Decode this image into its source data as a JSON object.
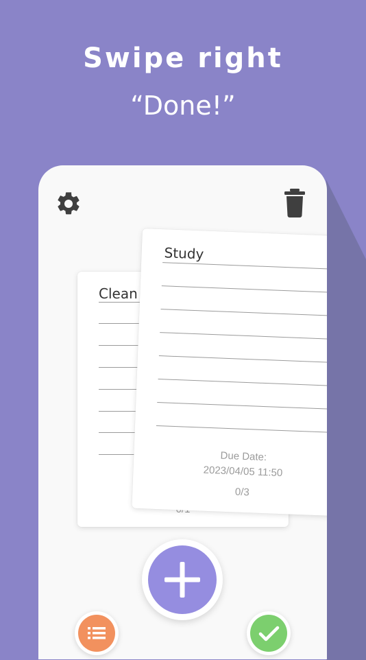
{
  "promo": {
    "headline": "Swipe right",
    "subline": "“Done!”"
  },
  "toolbar": {
    "settings_icon": "gear-icon",
    "delete_icon": "trash-icon"
  },
  "cards": {
    "back": {
      "title": "Clean m",
      "progress": "0/1"
    },
    "front": {
      "title": "Study",
      "due_label": "Due Date:",
      "due_value": "2023/04/05 11:50",
      "progress": "0/3"
    }
  },
  "actions": {
    "add_icon": "plus-icon",
    "list_icon": "list-icon",
    "done_icon": "check-icon"
  },
  "colors": {
    "background": "#8a84c8",
    "accent": "#958de0",
    "list_button": "#f2915e",
    "done_button": "#7ccf6e"
  }
}
